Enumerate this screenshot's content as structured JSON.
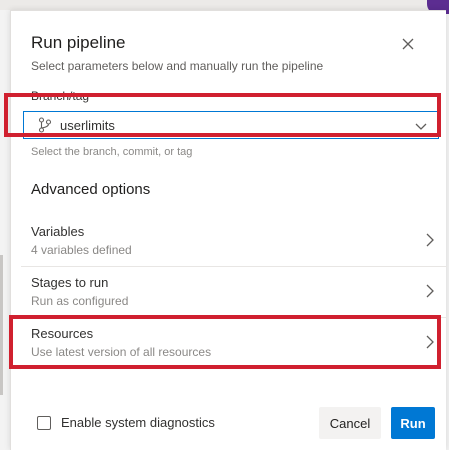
{
  "dialog": {
    "title": "Run pipeline",
    "subtitle": "Select parameters below and manually run the pipeline",
    "close_icon": "close-icon"
  },
  "branch": {
    "label": "Branch/tag",
    "value": "userlimits",
    "icon": "git-branch-icon",
    "helper": "Select the branch, commit, or tag"
  },
  "advanced": {
    "title": "Advanced options",
    "items": [
      {
        "title": "Variables",
        "subtitle": "4 variables defined"
      },
      {
        "title": "Stages to run",
        "subtitle": "Run as configured"
      },
      {
        "title": "Resources",
        "subtitle": "Use latest version of all resources"
      }
    ]
  },
  "footer": {
    "diagnostics_label": "Enable system diagnostics",
    "diagnostics_checked": false,
    "cancel_label": "Cancel",
    "run_label": "Run"
  },
  "colors": {
    "accent": "#0078d4",
    "highlight": "#d0202f"
  }
}
